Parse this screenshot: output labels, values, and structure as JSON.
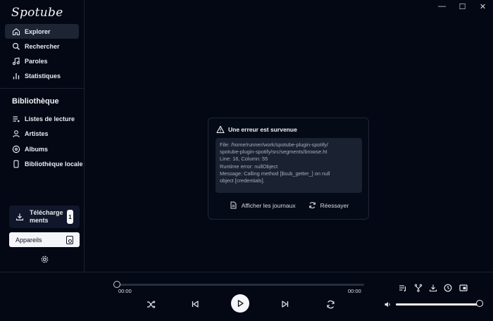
{
  "app": {
    "name": "Spotube"
  },
  "window_controls": {
    "minimize": "—",
    "maximize": "☐",
    "close": "✕"
  },
  "sidebar": {
    "nav": [
      {
        "label": "Explorer",
        "icon": "home-icon",
        "active": true
      },
      {
        "label": "Rechercher",
        "icon": "search-icon",
        "active": false
      },
      {
        "label": "Paroles",
        "icon": "music-note-icon",
        "active": false
      },
      {
        "label": "Statistiques",
        "icon": "bar-chart-icon",
        "active": false
      }
    ],
    "library_title": "Bibliothèque",
    "library": [
      {
        "label": "Listes de lecture",
        "icon": "playlist-icon"
      },
      {
        "label": "Artistes",
        "icon": "person-icon"
      },
      {
        "label": "Albums",
        "icon": "disc-icon"
      },
      {
        "label": "Bibliothèque locale",
        "icon": "phone-icon"
      }
    ],
    "downloads": {
      "label": "Téléchargements",
      "badge": "1"
    },
    "devices": {
      "label": "Appareils"
    }
  },
  "error": {
    "title": "Une erreur est survenue",
    "lines": [
      "File: /home/runner/work/spotube-plugin-spotify/",
      "spotube-plugin-spotify/src/segments/browse.ht",
      "Line: 16, Column: 55",
      "Runtime error: nullObject",
      "Message: Calling method [$sub_getter_] on null",
      "object [credentials]."
    ],
    "show_logs": "Afficher les journaux",
    "retry": "Réessayer"
  },
  "player": {
    "position": "00:00",
    "duration": "00:00",
    "progress": 0,
    "volume": 1
  },
  "colors": {
    "background": "#030814",
    "sidebar_active": "#1d2433",
    "card": "#1a2130"
  }
}
